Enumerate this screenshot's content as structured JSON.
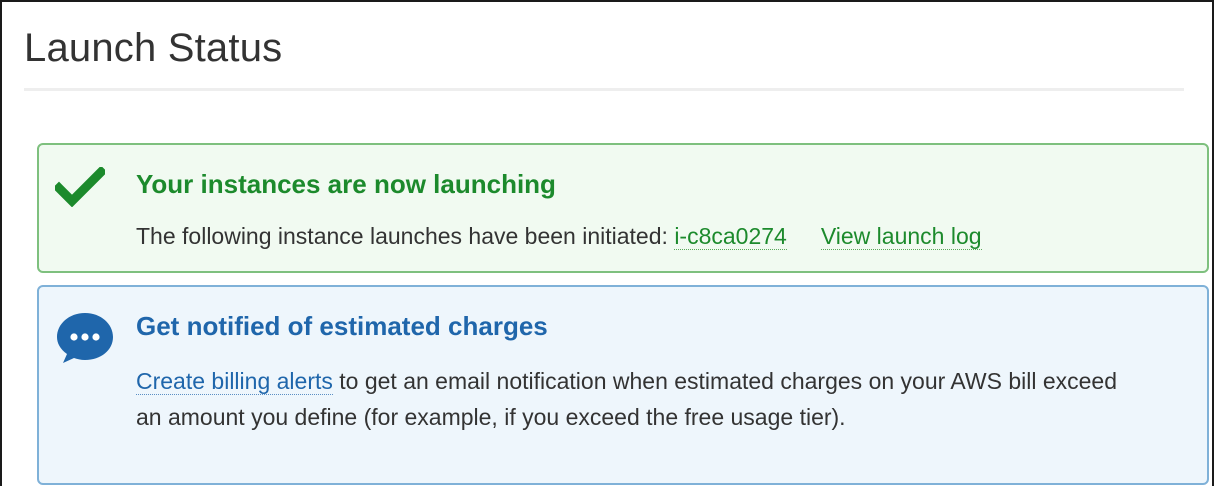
{
  "page": {
    "title": "Launch Status"
  },
  "success_alert": {
    "icon": "checkmark-icon",
    "heading": "Your instances are now launching",
    "body_text": "The following instance launches have been initiated: ",
    "instance_id_link": "i-c8ca0274",
    "view_log_link": "View launch log",
    "color": "#1c8a2c"
  },
  "info_alert": {
    "icon": "chat-bubble-icon",
    "heading": "Get notified of estimated charges",
    "billing_link": "Create billing alerts",
    "body_text": " to get an email notification when estimated charges on your AWS bill exceed an amount you define (for example, if you exceed the free usage tier).",
    "color": "#1f66ab"
  }
}
